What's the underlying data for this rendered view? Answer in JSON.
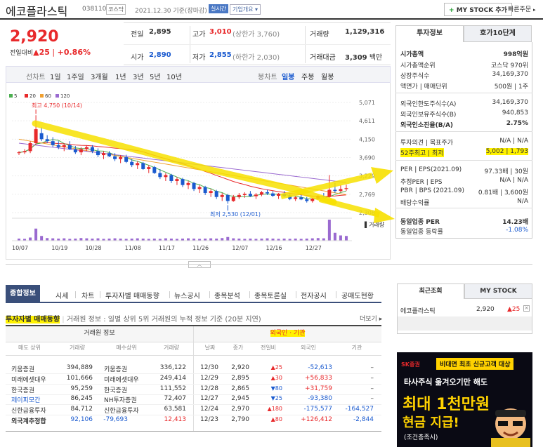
{
  "header": {
    "name": "에코플라스틱",
    "code": "038110",
    "market": "코스닥",
    "date": "2021.12.30 기준(장마감)",
    "live": "실시간",
    "company_info": "기업개요",
    "mystock_btn": "MY STOCK 추가",
    "fast_order": "빠른주문"
  },
  "price": {
    "current": "2,920",
    "change_label": "전일대비",
    "change": "▲25",
    "change_pct": "+0.86%"
  },
  "quote": {
    "prev_label": "전일",
    "prev": "2,895",
    "high_label": "고가",
    "high": "3,010",
    "high_limit": "(상한가 3,760)",
    "volume_label": "거래량",
    "volume": "1,129,316",
    "open_label": "시가",
    "open": "2,890",
    "low_label": "저가",
    "low": "2,855",
    "low_limit": "(하한가 2,030)",
    "amount_label": "거래대금",
    "amount": "3,309",
    "amount_unit": "백만"
  },
  "period": {
    "items": [
      "선차트",
      "1일",
      "1주일",
      "3개월",
      "1년",
      "3년",
      "5년",
      "10년"
    ],
    "right": [
      "봉차트",
      "일봉",
      "주봉",
      "월봉"
    ]
  },
  "chart_data": {
    "type": "candlestick",
    "legend": [
      "5",
      "20",
      "60",
      "120"
    ],
    "legend_colors": [
      "#4caf50",
      "#e8292b",
      "#f0a030",
      "#9a6ad0"
    ],
    "x_ticks": [
      "10/07",
      "10/19",
      "10/28",
      "11/08",
      "11/17",
      "11/26",
      "12/07",
      "12/16",
      "12/27"
    ],
    "y_ticks": [
      5071,
      4611,
      4150,
      3690,
      3229,
      2769,
      2308
    ],
    "ylim": [
      2308,
      5071
    ],
    "high_note": "최고 4,750 (10/14)",
    "low_note": "최저 2,530 (12/01)",
    "volume_label": "거래량",
    "candles": [
      [
        3800,
        3850,
        3750,
        3820
      ],
      [
        3820,
        3900,
        3780,
        3850
      ],
      [
        3850,
        4100,
        3800,
        4050
      ],
      [
        4050,
        4750,
        4000,
        4400
      ],
      [
        4300,
        4450,
        4100,
        4150
      ],
      [
        4150,
        4250,
        4050,
        4100
      ],
      [
        4100,
        4200,
        3950,
        4000
      ],
      [
        4000,
        4100,
        3900,
        3950
      ],
      [
        3950,
        4050,
        3850,
        4000
      ],
      [
        4000,
        4100,
        3880,
        3900
      ],
      [
        3900,
        3980,
        3780,
        3820
      ],
      [
        3820,
        3950,
        3750,
        3900
      ],
      [
        3900,
        4000,
        3850,
        3950
      ],
      [
        3950,
        4000,
        3800,
        3850
      ],
      [
        3850,
        3920,
        3700,
        3750
      ],
      [
        3750,
        3850,
        3650,
        3800
      ],
      [
        3800,
        3850,
        3700,
        3720
      ],
      [
        3720,
        3800,
        3600,
        3650
      ],
      [
        3650,
        3750,
        3550,
        3700
      ],
      [
        3700,
        3760,
        3550,
        3580
      ],
      [
        3580,
        3650,
        3450,
        3500
      ],
      [
        3500,
        3600,
        3400,
        3550
      ],
      [
        3550,
        3580,
        3380,
        3400
      ],
      [
        3400,
        3500,
        3300,
        3450
      ],
      [
        3450,
        3480,
        3280,
        3300
      ],
      [
        3300,
        3400,
        3150,
        3200
      ],
      [
        3200,
        3300,
        3100,
        3250
      ],
      [
        3250,
        3280,
        3050,
        3100
      ],
      [
        3100,
        3200,
        3000,
        3150
      ],
      [
        3150,
        3180,
        2950,
        3000
      ],
      [
        3000,
        3100,
        2900,
        3050
      ],
      [
        3050,
        3080,
        2850,
        2900
      ],
      [
        2900,
        3000,
        2800,
        2950
      ],
      [
        2950,
        2980,
        2750,
        2800
      ],
      [
        2800,
        2900,
        2700,
        2850
      ],
      [
        2850,
        2880,
        2650,
        2700
      ],
      [
        2700,
        2800,
        2600,
        2750
      ],
      [
        2750,
        2780,
        2530,
        2600
      ],
      [
        2600,
        2750,
        2580,
        2700
      ],
      [
        2700,
        2800,
        2650,
        2750
      ],
      [
        2750,
        2820,
        2680,
        2780
      ],
      [
        2780,
        2850,
        2700,
        2720
      ],
      [
        2720,
        2800,
        2650,
        2760
      ],
      [
        2760,
        2850,
        2720,
        2820
      ],
      [
        2820,
        2880,
        2750,
        2790
      ],
      [
        2790,
        2850,
        2700,
        2730
      ],
      [
        2730,
        2800,
        2650,
        2780
      ],
      [
        2780,
        2850,
        2700,
        2720
      ],
      [
        2720,
        2780,
        2620,
        2650
      ],
      [
        2650,
        2720,
        2600,
        2690
      ],
      [
        2690,
        2750,
        2620,
        2640
      ],
      [
        2640,
        2700,
        2560,
        2600
      ],
      [
        2600,
        2680,
        2560,
        2660
      ],
      [
        2660,
        2750,
        2620,
        2720
      ],
      [
        2720,
        2800,
        2680,
        2700
      ],
      [
        2700,
        3250,
        2680,
        2880
      ],
      [
        2880,
        3050,
        2800,
        2850
      ],
      [
        2850,
        3000,
        2820,
        2900
      ],
      [
        2900,
        3010,
        2855,
        2920
      ]
    ],
    "volumes": [
      8,
      7,
      12,
      46,
      18,
      10,
      9,
      8,
      9,
      7,
      8,
      10,
      9,
      8,
      9,
      7,
      8,
      9,
      8,
      7,
      8,
      9,
      8,
      7,
      8,
      7,
      9,
      8,
      7,
      8,
      9,
      8,
      7,
      8,
      9,
      8,
      10,
      14,
      9,
      8,
      7,
      8,
      7,
      8,
      9,
      8,
      7,
      8,
      7,
      8,
      7,
      8,
      9,
      10,
      9,
      80,
      30,
      20,
      18
    ]
  },
  "right_tabs": [
    "투자정보",
    "호가10단계"
  ],
  "info": [
    {
      "k": "시가총액",
      "v": "998억원",
      "bold": true
    },
    {
      "k": "시가총액순위",
      "v": "코스닥 970위"
    },
    {
      "k": "상장주식수",
      "v": "34,169,370"
    },
    {
      "k": "액면가 | 매매단위",
      "v": "500원 | 1주"
    },
    {
      "k": "외국인한도주식수(A)",
      "v": "34,169,370"
    },
    {
      "k": "외국인보유주식수(B)",
      "v": "940,853"
    },
    {
      "k": "외국인소진율(B/A)",
      "v": "2.75%",
      "bold": true
    },
    {
      "k": "투자의견 | 목표주가",
      "v": "N/A | N/A"
    },
    {
      "k": "52주최고 | 최저",
      "v": "5,002 | 1,793"
    },
    {
      "k": "PER | EPS(2021.09)",
      "v": "97.33배 | 30원"
    },
    {
      "k": "추정PER | EPS",
      "v": "N/A | N/A"
    },
    {
      "k": "PBR | BPS (2021.09)",
      "v": "0.81배 | 3,600원"
    },
    {
      "k": "배당수익률",
      "v": "N/A"
    },
    {
      "k": "동일업종 PER",
      "v": "14.23배",
      "bold": true
    },
    {
      "k": "동일업종 등락률",
      "v": "-1.08%",
      "blue": true
    }
  ],
  "bottom_tabs": [
    "종합정보",
    "시세",
    "차트",
    "투자자별 매매동향",
    "뉴스공시",
    "종목분석",
    "종목토론실",
    "전자공시",
    "공매도현황"
  ],
  "investor": {
    "title": "투자자별 매매동향",
    "desc": "거래원 정보 : 일별 상위 5위 거래원의 누적 정보 기준 (20분 지연)",
    "more": "더보기",
    "group1": "거래원 정보",
    "group2": "외국인 · 기관",
    "cols": [
      "매도 상위",
      "거래량",
      "매수상위",
      "거래량",
      "날짜",
      "종가",
      "전일비",
      "외국인",
      "기관"
    ],
    "rows": [
      [
        "키움증권",
        "394,889",
        "키움증권",
        "336,122",
        "12/30",
        "2,920",
        "▲25",
        "-52,613",
        "–"
      ],
      [
        "미래에셋대우",
        "101,666",
        "미래에셋대우",
        "249,414",
        "12/29",
        "2,895",
        "▲30",
        "+56,833",
        "–"
      ],
      [
        "한국증권",
        "95,259",
        "한국증권",
        "111,552",
        "12/28",
        "2,865",
        "▼80",
        "+31,759",
        "–"
      ],
      [
        "제이피모간",
        "86,245",
        "NH투자증권",
        "72,407",
        "12/27",
        "2,945",
        "▼25",
        "-93,380",
        "–"
      ],
      [
        "신한금융투자",
        "84,712",
        "신한금융투자",
        "63,581",
        "12/24",
        "2,970",
        "▲180",
        "-175,577",
        "-164,527"
      ],
      [
        "외국계추정합",
        "92,106",
        "-79,693",
        "12,413",
        "12/23",
        "2,790",
        "▲80",
        "+126,412",
        "-2,844"
      ]
    ]
  },
  "recent": {
    "tabs": [
      "최근조회",
      "MY STOCK"
    ],
    "name": "에코플라스틱",
    "price": "2,920",
    "chg": "▲25"
  },
  "ad": {
    "brand": "SK증권",
    "badge": "비대면 최초 신규고객 대상",
    "l1": "타사주식 옮겨오기만 해도",
    "l2": "최대 1천만원",
    "l3": "현금 지급!",
    "l4": "(조건충족시)"
  }
}
